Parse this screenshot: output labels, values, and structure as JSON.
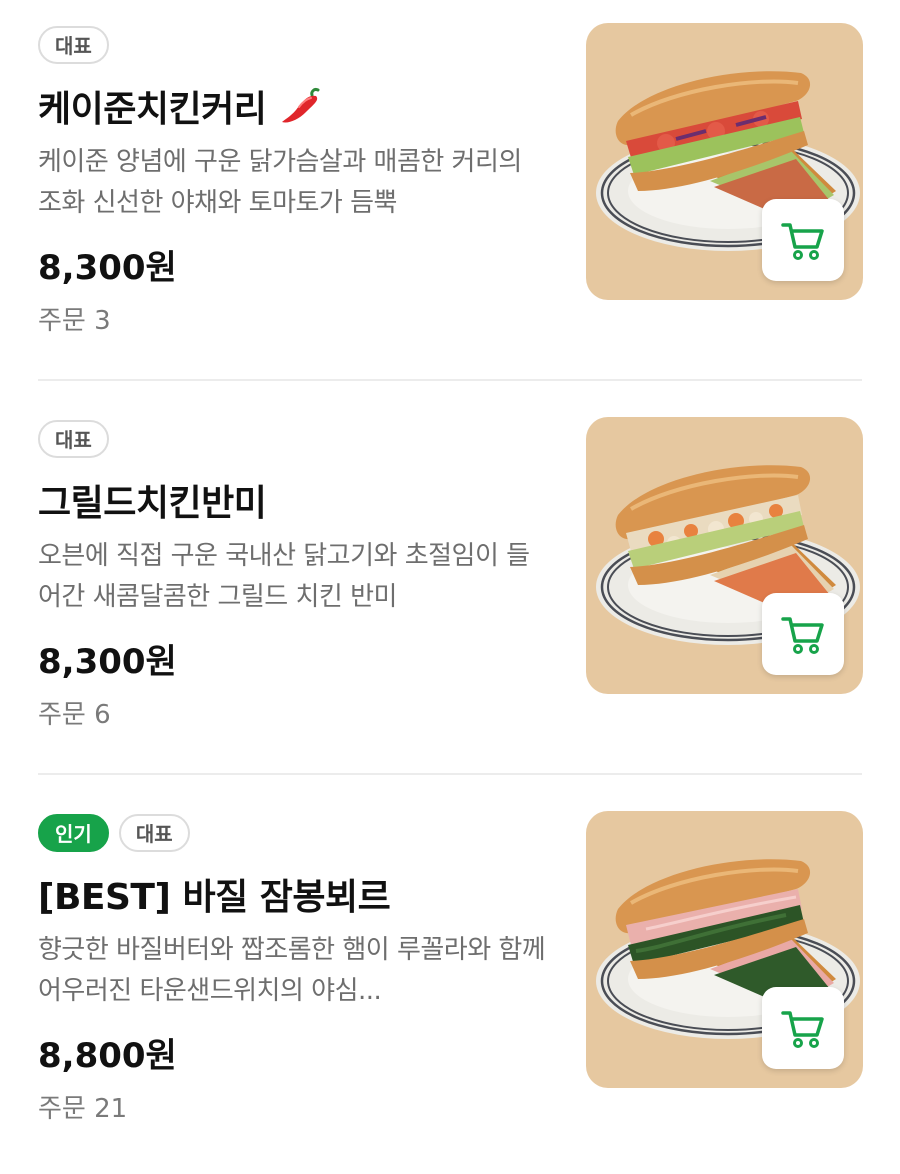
{
  "menu": {
    "items": [
      {
        "badges": [
          "대표"
        ],
        "title": "케이준치킨커리",
        "spicy": true,
        "description": "케이준 양념에 구운 닭가슴살과 매콤한 커리의 조화 신선한 야채와 토마토가 듬뿍",
        "price": "8,300원",
        "orders": "주문 3",
        "filling": "tomato"
      },
      {
        "badges": [
          "대표"
        ],
        "title": "그릴드치킨반미",
        "spicy": false,
        "description": "오븐에 직접 구운 국내산 닭고기와 초절임이 들어간 새콤달콤한 그릴드 치킨 반미",
        "price": "8,300원",
        "orders": "주문 6",
        "filling": "chicken"
      },
      {
        "badges": [
          "인기",
          "대표"
        ],
        "title": "[BEST] 바질 잠봉뵈르",
        "spicy": false,
        "description": "향긋한 바질버터와 짭조롬한 햄이 루꼴라와 함께 어우러진 타운샌드위치의 야심...",
        "price": "8,800원",
        "orders": "주문 21",
        "filling": "ham"
      }
    ]
  },
  "colors": {
    "accent_green": "#17a34a",
    "thumb_bg": "#e6c8a0"
  },
  "icons": {
    "cart": "cart-icon",
    "spicy": "chili-pepper-icon"
  }
}
